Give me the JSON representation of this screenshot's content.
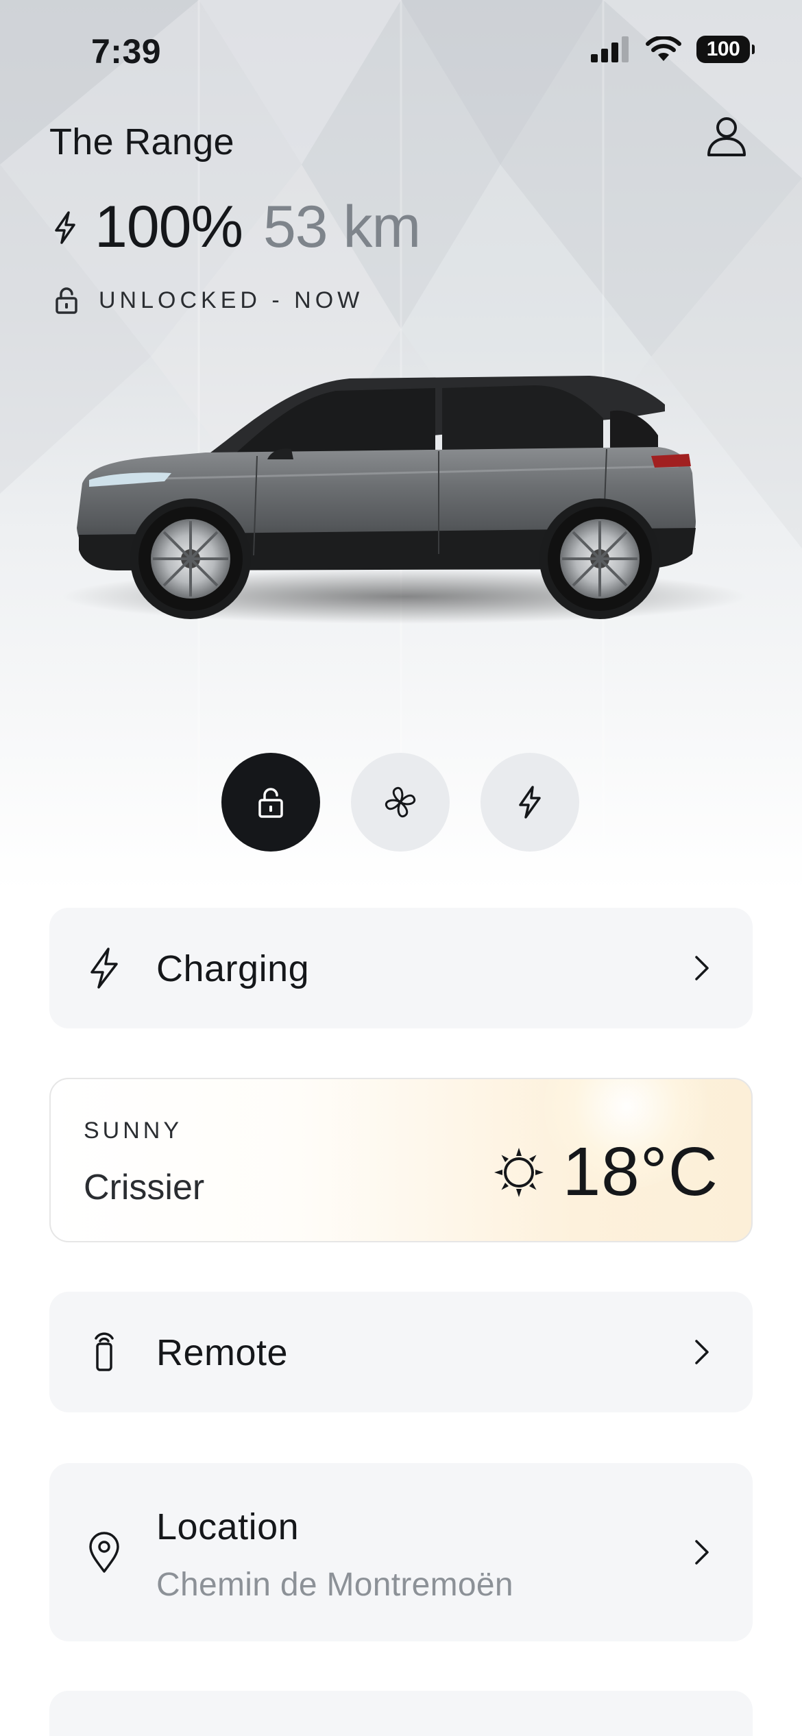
{
  "status_bar": {
    "time": "7:39",
    "battery": "100"
  },
  "header": {
    "title": "The Range",
    "profile_icon": "person-icon"
  },
  "vehicle": {
    "charge_percent": "100%",
    "range": "53 km",
    "lock_status": "UNLOCKED - NOW"
  },
  "quick_actions": [
    {
      "icon": "lock-icon",
      "active": true
    },
    {
      "icon": "fan-icon",
      "active": false
    },
    {
      "icon": "bolt-icon",
      "active": false
    }
  ],
  "cards": {
    "charging": {
      "label": "Charging",
      "icon": "bolt-icon"
    },
    "remote": {
      "label": "Remote",
      "icon": "remote-key-icon"
    },
    "location": {
      "label": "Location",
      "address": "Chemin de Montremoën",
      "icon": "map-pin-icon"
    }
  },
  "weather": {
    "condition": "SUNNY",
    "city": "Crissier",
    "temperature": "18°C",
    "icon": "sun-icon"
  },
  "colors": {
    "primary": "#15171a",
    "muted": "#7e848b",
    "card_bg": "#f5f6f8",
    "active_action_bg": "#15171a",
    "inactive_action_bg": "#e9ebee"
  }
}
